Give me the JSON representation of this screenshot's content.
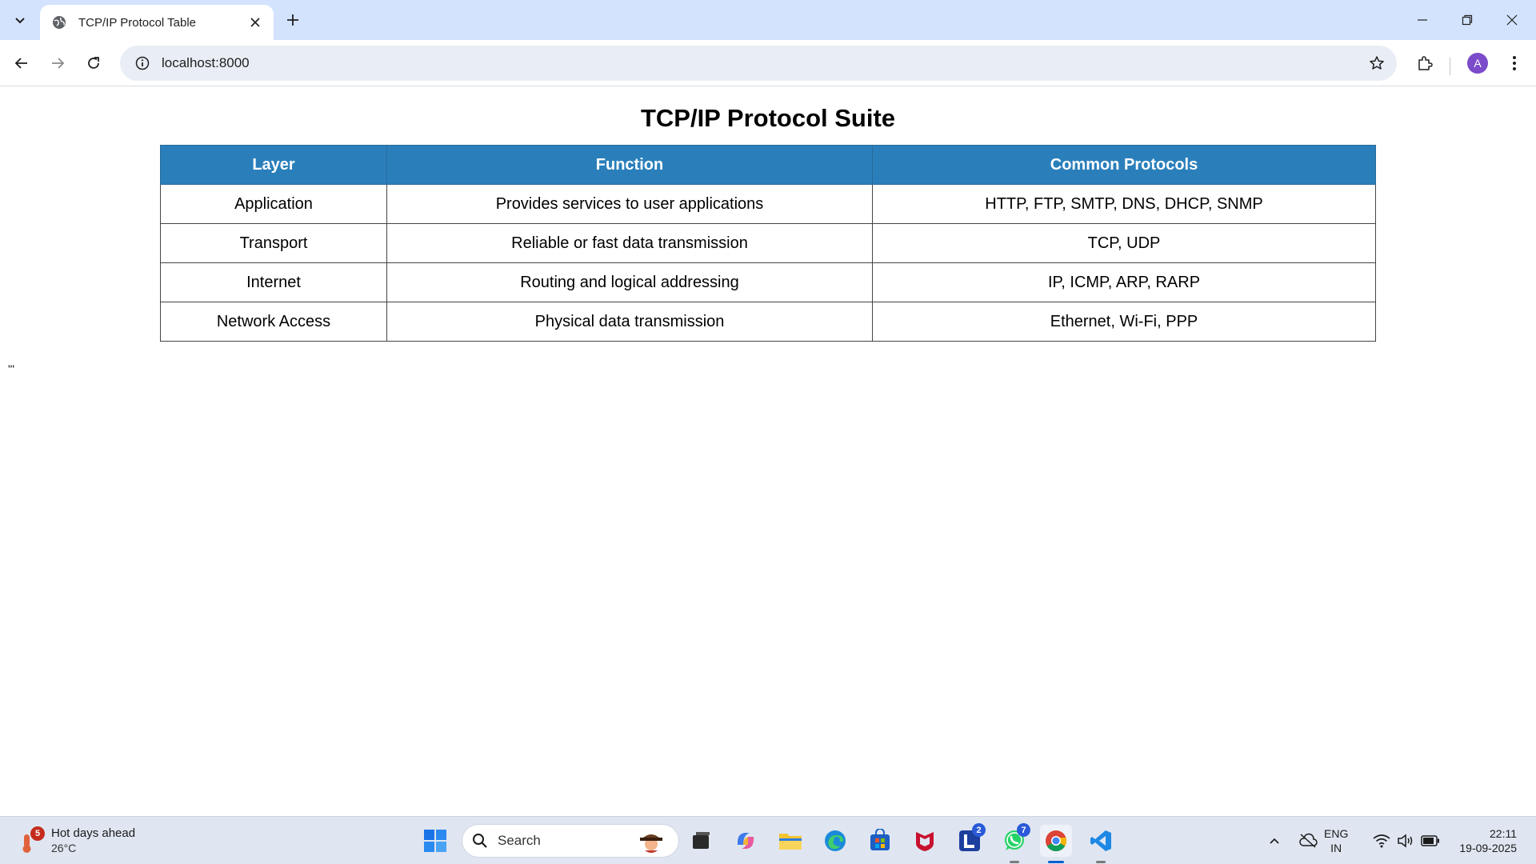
{
  "browser": {
    "tab_title": "TCP/IP Protocol Table",
    "url": "localhost:8000",
    "profile_initial": "A"
  },
  "page": {
    "title": "TCP/IP Protocol Suite",
    "table": {
      "headers": [
        "Layer",
        "Function",
        "Common Protocols"
      ],
      "rows": [
        [
          "Application",
          "Provides services to user applications",
          "HTTP, FTP, SMTP, DNS, DHCP, SNMP"
        ],
        [
          "Transport",
          "Reliable or fast data transmission",
          "TCP, UDP"
        ],
        [
          "Internet",
          "Routing and logical addressing",
          "IP, ICMP, ARP, RARP"
        ],
        [
          "Network Access",
          "Physical data transmission",
          "Ethernet, Wi-Fi, PPP"
        ]
      ]
    },
    "stray_text": "'''"
  },
  "taskbar": {
    "weather": {
      "headline": "Hot days ahead",
      "temp": "26°C",
      "badge": "5"
    },
    "search_label": "Search",
    "badges": {
      "l_app": "2",
      "whatsapp": "7"
    },
    "language": {
      "line1": "ENG",
      "line2": "IN"
    },
    "clock": {
      "time": "22:11",
      "date": "19-09-2025"
    }
  },
  "colors": {
    "table_header_bg": "#2a7fbb",
    "tabstrip_bg": "#d3e3fd",
    "omnibox_bg": "#e9eef6",
    "taskbar_bg": "#dfe6f1",
    "avatar_bg": "#7b4bc9"
  },
  "icons": [
    "tab-search-icon",
    "globe-icon",
    "close-icon",
    "plus-icon",
    "minimize-icon",
    "restore-icon",
    "back-icon",
    "forward-icon",
    "reload-icon",
    "info-icon",
    "star-icon",
    "extensions-icon",
    "menu-icon",
    "windows-start-icon",
    "search-icon",
    "file-explorer-icon",
    "edge-icon",
    "store-icon",
    "mcafee-icon",
    "whatsapp-icon",
    "chrome-icon",
    "vscode-icon",
    "wifi-icon",
    "volume-icon",
    "battery-icon"
  ]
}
